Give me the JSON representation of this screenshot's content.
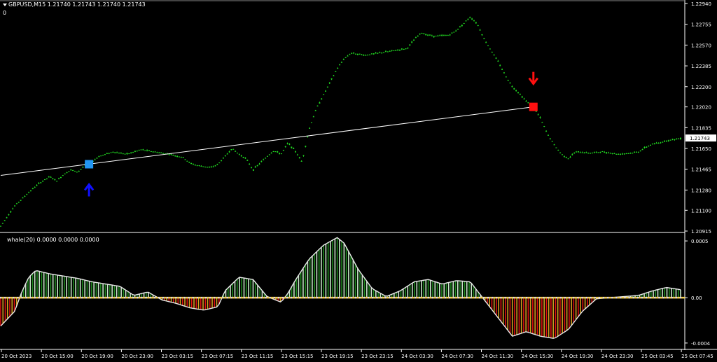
{
  "chart_title": "GBPUSD,M15  1.21740 1.21743 1.21740 1.21743",
  "chart_sub": "0",
  "indicator_title": "whale(20) 0.0000 0.0000 0.0000",
  "current_price": "1.21743",
  "colors": {
    "background": "#000000",
    "bull_candle": "#22dd22",
    "line": "#ffffff",
    "buy_marker": "#2196f3",
    "buy_arrow": "#1010ff",
    "sell_marker": "#ff1010",
    "hist_pos": "#1e8c1e",
    "hist_neg": "#e01010",
    "hist_neg_light": "#d4a020",
    "zero_line": "#f2d050"
  },
  "chart_data": [
    {
      "type": "candlestick",
      "series_name": "GBPUSD,M15",
      "y_ticks": [
        "1.22940",
        "1.22755",
        "1.22570",
        "1.22385",
        "1.22200",
        "1.22020",
        "1.21835",
        "1.21650",
        "1.21465",
        "1.21280",
        "1.21100",
        "1.20915"
      ],
      "ylim": [
        1.20915,
        1.2294
      ],
      "x_ticks": [
        "20 Oct 2023",
        "20 Oct 15:00",
        "20 Oct 19:00",
        "20 Oct 23:00",
        "23 Oct 03:15",
        "23 Oct 07:15",
        "23 Oct 11:15",
        "23 Oct 15:15",
        "23 Oct 19:15",
        "23 Oct 23:15",
        "24 Oct 03:30",
        "24 Oct 07:30",
        "24 Oct 11:30",
        "24 Oct 15:30",
        "24 Oct 19:30",
        "24 Oct 23:30",
        "25 Oct 03:45",
        "25 Oct 07:45"
      ],
      "close_path": [
        [
          0,
          1.2096
        ],
        [
          2,
          1.2114
        ],
        [
          4,
          1.2126
        ],
        [
          5.5,
          1.2134
        ],
        [
          7,
          1.214
        ],
        [
          8,
          1.2136
        ],
        [
          9,
          1.2142
        ],
        [
          10,
          1.2146
        ],
        [
          11,
          1.2144
        ],
        [
          12,
          1.215
        ],
        [
          13,
          1.2153
        ],
        [
          14,
          1.2158
        ],
        [
          16,
          1.2162
        ],
        [
          18,
          1.216
        ],
        [
          20,
          1.2164
        ],
        [
          22,
          1.2162
        ],
        [
          24,
          1.216
        ],
        [
          26,
          1.2157
        ],
        [
          27,
          1.2152
        ],
        [
          28,
          1.215
        ],
        [
          30,
          1.2148
        ],
        [
          31,
          1.2151
        ],
        [
          32,
          1.2158
        ],
        [
          33,
          1.2165
        ],
        [
          34,
          1.216
        ],
        [
          35,
          1.2156
        ],
        [
          36,
          1.2146
        ],
        [
          37,
          1.2152
        ],
        [
          38,
          1.2158
        ],
        [
          39,
          1.2163
        ],
        [
          40,
          1.216
        ],
        [
          41,
          1.217
        ],
        [
          42,
          1.2163
        ],
        [
          43,
          1.2153
        ],
        [
          44,
          1.2182
        ],
        [
          45,
          1.22
        ],
        [
          46,
          1.2212
        ],
        [
          47,
          1.2224
        ],
        [
          48,
          1.2236
        ],
        [
          49,
          1.2245
        ],
        [
          50,
          1.225
        ],
        [
          52,
          1.2248
        ],
        [
          54,
          1.225
        ],
        [
          56,
          1.2252
        ],
        [
          58,
          1.2254
        ],
        [
          59,
          1.2262
        ],
        [
          60,
          1.2268
        ],
        [
          61,
          1.2266
        ],
        [
          62,
          1.2265
        ],
        [
          64,
          1.2266
        ],
        [
          65,
          1.227
        ],
        [
          66,
          1.2276
        ],
        [
          67,
          1.2282
        ],
        [
          68,
          1.2276
        ],
        [
          69,
          1.2262
        ],
        [
          70,
          1.2252
        ],
        [
          71,
          1.2242
        ],
        [
          72,
          1.223
        ],
        [
          73,
          1.222
        ],
        [
          74,
          1.2214
        ],
        [
          75,
          1.2207
        ],
        [
          76,
          1.2202
        ],
        [
          77,
          1.2192
        ],
        [
          78,
          1.2178
        ],
        [
          79,
          1.2168
        ],
        [
          80,
          1.216
        ],
        [
          81,
          1.2156
        ],
        [
          82,
          1.2162
        ],
        [
          84,
          1.2161
        ],
        [
          86,
          1.2162
        ],
        [
          88,
          1.216
        ],
        [
          90,
          1.2161
        ],
        [
          91,
          1.2162
        ],
        [
          92,
          1.2166
        ],
        [
          93,
          1.2169
        ],
        [
          94,
          1.217
        ],
        [
          95,
          1.2172
        ],
        [
          96,
          1.2173
        ],
        [
          97,
          1.21743
        ]
      ],
      "trend_line": {
        "from": [
          0,
          1.2141
        ],
        "to": [
          76,
          1.2202
        ]
      },
      "signals": [
        {
          "type": "buy",
          "x": 12.6,
          "price": 1.2151,
          "arrow": "up-arrow"
        },
        {
          "type": "sell",
          "x": 76,
          "price": 1.2202,
          "arrow": "down-arrow"
        }
      ]
    },
    {
      "type": "bar",
      "series_name": "whale(20)",
      "y_ticks": [
        "0.0005",
        "0.00",
        "-0.0004"
      ],
      "ylim": [
        -0.00045,
        0.00055
      ],
      "envelope": [
        [
          0,
          -0.00025
        ],
        [
          2,
          -0.00012
        ],
        [
          3,
          5e-05
        ],
        [
          4,
          0.00018
        ],
        [
          5,
          0.00024
        ],
        [
          7,
          0.00021
        ],
        [
          9,
          0.00019
        ],
        [
          11,
          0.00017
        ],
        [
          13,
          0.00014
        ],
        [
          15,
          0.00012
        ],
        [
          17,
          0.0001
        ],
        [
          19,
          2e-05
        ],
        [
          21,
          5e-05
        ],
        [
          23,
          -2e-05
        ],
        [
          25,
          -5e-05
        ],
        [
          27,
          -9e-05
        ],
        [
          29,
          -0.00011
        ],
        [
          31,
          -8e-05
        ],
        [
          32,
          6e-05
        ],
        [
          34,
          0.00018
        ],
        [
          36,
          0.00016
        ],
        [
          38,
          1e-05
        ],
        [
          40,
          -4e-05
        ],
        [
          41,
          4e-05
        ],
        [
          42,
          0.00015
        ],
        [
          44,
          0.00034
        ],
        [
          46,
          0.00046
        ],
        [
          48,
          0.00053
        ],
        [
          49,
          0.00048
        ],
        [
          51,
          0.00025
        ],
        [
          53,
          8e-05
        ],
        [
          55,
          1e-05
        ],
        [
          57,
          6e-05
        ],
        [
          59,
          0.00014
        ],
        [
          61,
          0.00016
        ],
        [
          63,
          0.00012
        ],
        [
          65,
          0.00015
        ],
        [
          67,
          0.00014
        ],
        [
          69,
          -2e-05
        ],
        [
          71,
          -0.00018
        ],
        [
          73,
          -0.00034
        ],
        [
          75,
          -0.0003
        ],
        [
          77,
          -0.00034
        ],
        [
          79,
          -0.00036
        ],
        [
          81,
          -0.00028
        ],
        [
          83,
          -0.00012
        ],
        [
          85,
          -1e-05
        ],
        [
          87,
          0.0
        ],
        [
          89,
          1e-05
        ],
        [
          91,
          2e-05
        ],
        [
          93,
          6e-05
        ],
        [
          95,
          9e-05
        ],
        [
          97,
          7e-05
        ]
      ]
    }
  ]
}
